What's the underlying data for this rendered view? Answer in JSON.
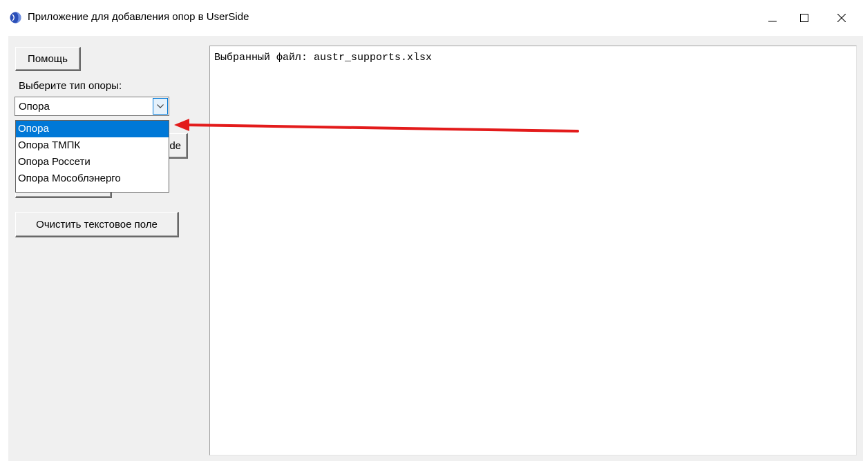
{
  "window": {
    "title": "Приложение для добавления опор в UserSide",
    "app_icon": "app-globe-icon",
    "controls": [
      "minimize-icon",
      "maximize-icon",
      "close-icon"
    ]
  },
  "left_panel": {
    "help_button": "Помощь",
    "support_type_label": "Выберите тип опоры:",
    "support_type_select": {
      "selected": "Опора",
      "options": [
        "Опора",
        "Опора ТМПК",
        "Опора Россети",
        "Опора Мособлэнерго"
      ],
      "highlighted_index": 0
    },
    "hidden_button_partial_text": "de",
    "clear_button": "Очистить текстовое поле"
  },
  "output": {
    "text": "Выбранный файл: austr_supports.xlsx"
  },
  "colors": {
    "selection": "#0078d7",
    "annotation_arrow": "#e31b1b",
    "panel_bg": "#f0f0f0"
  }
}
